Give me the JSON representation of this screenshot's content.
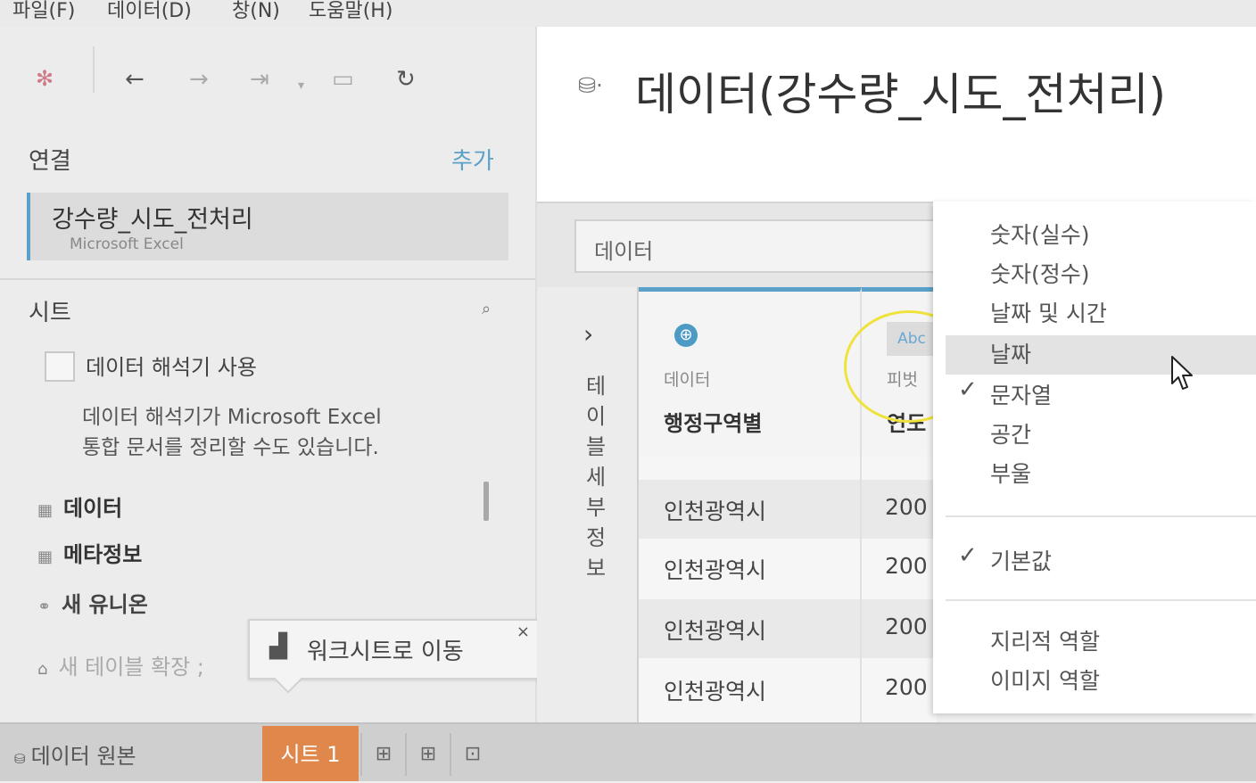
{
  "menubar": {
    "items": [
      "파일(F)",
      "데이터(D)",
      "창(N)",
      "도움말(H)"
    ]
  },
  "toolbar": {
    "icons": [
      "tableau-logo-icon",
      "back-arrow-icon",
      "forward-arrow-icon",
      "pause-icon",
      "save-icon",
      "refresh-icon"
    ]
  },
  "connections": {
    "title": "연결",
    "add_label": "추가",
    "items": [
      {
        "name": "강수량_시도_전처리",
        "type": "Microsoft Excel"
      }
    ]
  },
  "sheets": {
    "title": "시트",
    "interpreter": {
      "label": "데이터 해석기 사용",
      "desc_line1": "데이터 해석기가 Microsoft Excel",
      "desc_line2": "통합 문서를 정리할 수도 있습니다."
    },
    "items": [
      "데이터",
      "메타정보"
    ],
    "new_union": "새 유니온",
    "new_table_extension": "새 테이블 확장 ;"
  },
  "tooltip": {
    "label": "워크시트로 이동",
    "close": "×"
  },
  "bottom_tabs": {
    "data_source": "데이터 원본",
    "sheet1": "시트 1"
  },
  "main": {
    "title": "데이터(강수량_시도_전처리)",
    "search_placeholder": "데이터",
    "details_label": [
      "테",
      "이",
      "블",
      "세",
      "부",
      "정",
      "보"
    ],
    "columns": [
      {
        "type_label": "데이터",
        "name": "행정구역별"
      },
      {
        "type_icon": "Abc",
        "type_label": "피벗",
        "name": "연도"
      }
    ],
    "rows": [
      [
        "인천광역시",
        "200"
      ],
      [
        "인천광역시",
        "200"
      ],
      [
        "인천광역시",
        "200"
      ],
      [
        "인천광역시",
        "200"
      ]
    ]
  },
  "type_menu": {
    "options": [
      "숫자(실수)",
      "숫자(정수)",
      "날짜 및 시간",
      "날짜",
      "문자열",
      "공간",
      "부울"
    ],
    "hovered": "날짜",
    "checked": "문자열",
    "default_label": "기본값",
    "roles": [
      "지리적 역할",
      "이미지 역할"
    ]
  },
  "colors": {
    "accent_blue": "#5aa0c8",
    "sheet_tab_orange": "#e0884c",
    "highlight_yellow": "#f0e23c"
  }
}
